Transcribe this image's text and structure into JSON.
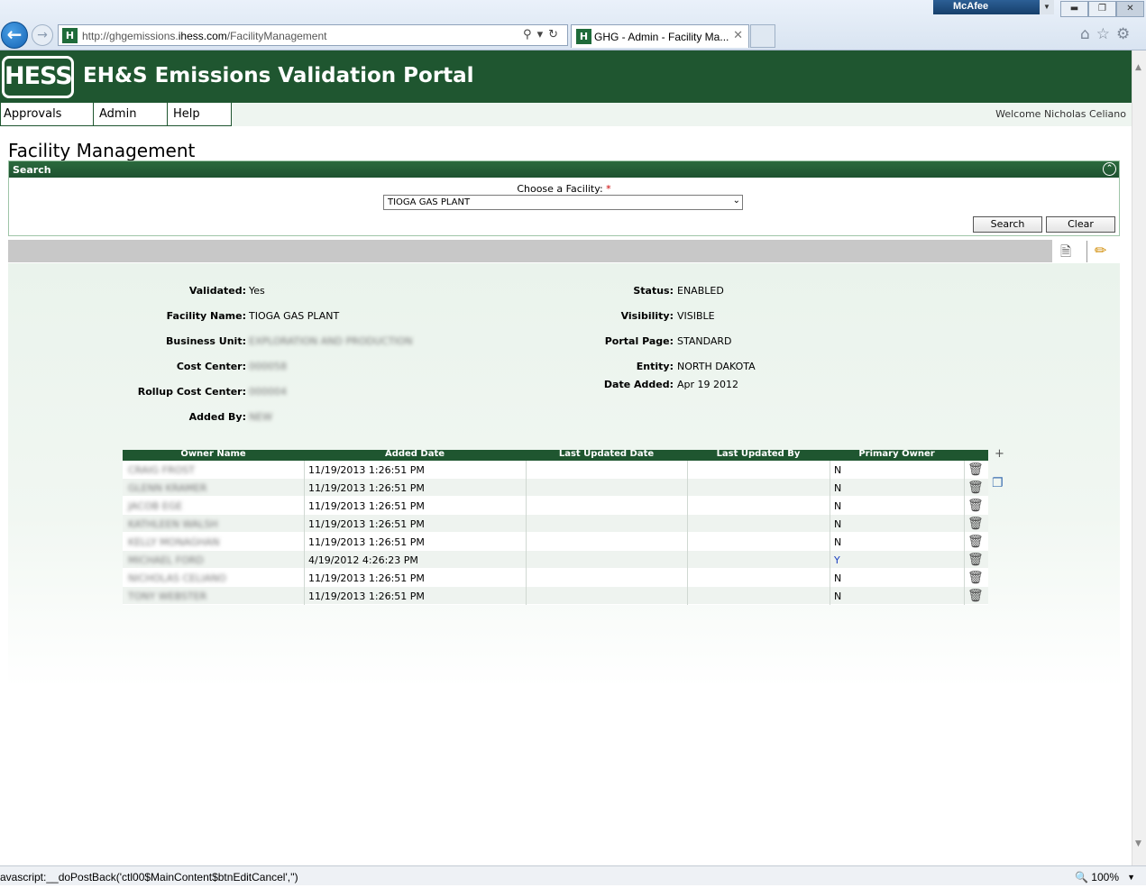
{
  "browser": {
    "url_prefix": "http://ghgemissions.",
    "url_domain": "ihess.com",
    "url_path": "/FacilityManagement",
    "tab_title": "GHG - Admin - Facility Ma...",
    "mcafee": "McAfee",
    "status_text": "avascript:__doPostBack('ctl00$MainContent$btnEditCancel','')",
    "zoom": "100%"
  },
  "header": {
    "logo": "HESS",
    "title": "EH&S Emissions Validation Portal"
  },
  "nav": {
    "items": [
      "Approvals",
      "Admin",
      "Help"
    ],
    "welcome": "Welcome Nicholas Celiano"
  },
  "page": {
    "heading": "Facility Management"
  },
  "search": {
    "panel_title": "Search",
    "choose_label": "Choose a Facility:",
    "required_mark": "*",
    "facility_value": "TIOGA GAS PLANT",
    "search_button": "Search",
    "clear_button": "Clear"
  },
  "details": {
    "validated_label": "Validated:",
    "validated": "Yes",
    "facility_name_label": "Facility Name:",
    "facility_name": "TIOGA GAS PLANT",
    "business_unit_label": "Business Unit:",
    "business_unit": "EXPLORATION AND PRODUCTION",
    "cost_center_label": "Cost Center:",
    "cost_center": "000058",
    "rollup_cost_center_label": "Rollup Cost Center:",
    "rollup_cost_center": "000004",
    "added_by_label": "Added By:",
    "added_by": "NEW",
    "status_label": "Status:",
    "status": "ENABLED",
    "visibility_label": "Visibility:",
    "visibility": "VISIBLE",
    "portal_page_label": "Portal Page:",
    "portal_page": "STANDARD",
    "entity_label": "Entity:",
    "entity": "NORTH DAKOTA",
    "date_added_label": "Date Added:",
    "date_added": "Apr 19 2012"
  },
  "owners": {
    "columns": [
      "Owner Name",
      "Added Date",
      "Last Updated Date",
      "Last Updated By",
      "Primary Owner"
    ],
    "rows": [
      {
        "name": "CRAIG FROST",
        "added": "11/19/2013 1:26:51 PM",
        "updated": "",
        "updated_by": "",
        "primary": "N"
      },
      {
        "name": "GLENN KRAMER",
        "added": "11/19/2013 1:26:51 PM",
        "updated": "",
        "updated_by": "",
        "primary": "N"
      },
      {
        "name": "JACOB EGE",
        "added": "11/19/2013 1:26:51 PM",
        "updated": "",
        "updated_by": "",
        "primary": "N"
      },
      {
        "name": "KATHLEEN WALSH",
        "added": "11/19/2013 1:26:51 PM",
        "updated": "",
        "updated_by": "",
        "primary": "N"
      },
      {
        "name": "KELLY MONAGHAN",
        "added": "11/19/2013 1:26:51 PM",
        "updated": "",
        "updated_by": "",
        "primary": "N"
      },
      {
        "name": "MICHAEL FORD",
        "added": "4/19/2012 4:26:23 PM",
        "updated": "",
        "updated_by": "",
        "primary": "Y"
      },
      {
        "name": "NICHOLAS CELIANO",
        "added": "11/19/2013 1:26:51 PM",
        "updated": "",
        "updated_by": "",
        "primary": "N"
      },
      {
        "name": "TONY WEBSTER",
        "added": "11/19/2013 1:26:51 PM",
        "updated": "",
        "updated_by": "",
        "primary": "N"
      }
    ]
  }
}
